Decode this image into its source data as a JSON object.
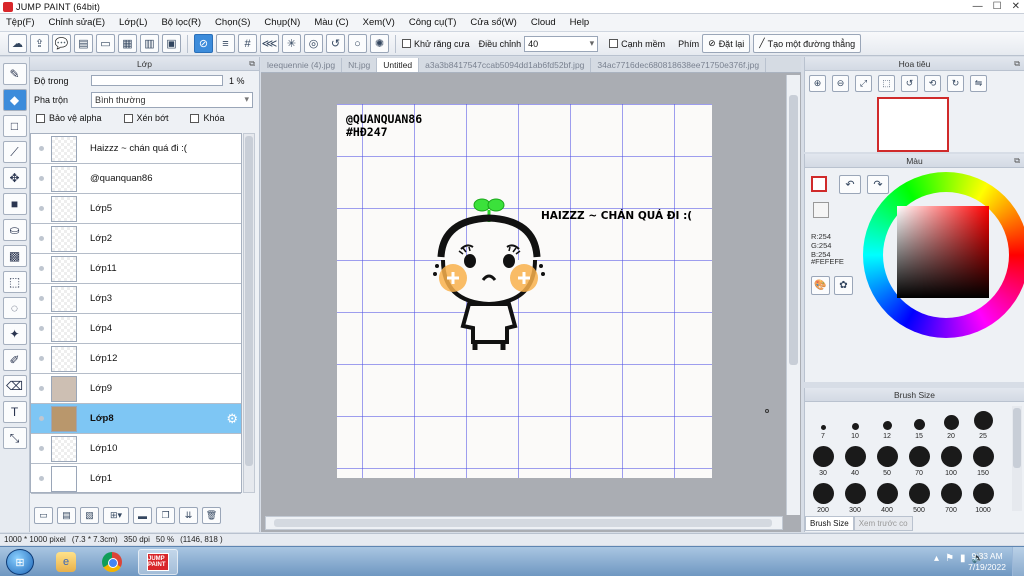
{
  "window": {
    "title": "JUMP PAINT (64bit)",
    "controls": [
      "—",
      "☐",
      "✕"
    ]
  },
  "menu": [
    "Tệp(F)",
    "Chỉnh sửa(E)",
    "Lớp(L)",
    "Bộ lọc(R)",
    "Chọn(S)",
    "Chụp(N)",
    "Màu (C)",
    "Xem(V)",
    "Công cụ(T)",
    "Cửa sổ(W)",
    "Cloud",
    "Help"
  ],
  "toolbar": {
    "antialias_label": "Khử răng cưa",
    "adjust_label": "Điều chỉnh",
    "adjust_value": "40",
    "soft_edge_label": "Cạnh mềm",
    "keyboard_label": "Phím",
    "reset_label": "Đặt lại",
    "straight_line_label": "Tạo một đường thẳng"
  },
  "layer_panel": {
    "title": "Lớp",
    "opacity_label": "Độ trong",
    "opacity_value": "1 %",
    "blend_label": "Pha trộn",
    "blend_value": "Bình thường",
    "protect_alpha": "Bảo vệ alpha",
    "clip": "Xén bớt",
    "lock": "Khóa",
    "layers": [
      {
        "name": "Haizzz ~ chán quá đi :(",
        "selected": false
      },
      {
        "name": "@quanquan86",
        "selected": false
      },
      {
        "name": "Lớp5",
        "selected": false
      },
      {
        "name": "Lớp2",
        "selected": false
      },
      {
        "name": "Lớp11",
        "selected": false
      },
      {
        "name": "Lớp3",
        "selected": false
      },
      {
        "name": "Lớp4",
        "selected": false
      },
      {
        "name": "Lớp12",
        "selected": false
      },
      {
        "name": "Lớp9",
        "selected": false
      },
      {
        "name": "Lớp8",
        "selected": true
      },
      {
        "name": "Lớp10",
        "selected": false
      },
      {
        "name": "Lớp1",
        "selected": false
      }
    ]
  },
  "canvas": {
    "tabs": [
      {
        "label": "leequennie (4).jpg",
        "active": false
      },
      {
        "label": "Nt.jpg",
        "active": false
      },
      {
        "label": "Untitled",
        "active": true
      },
      {
        "label": "a3a3b8417547ccab5094dd1ab6fd52bf.jpg",
        "active": false
      },
      {
        "label": "34ac7716dec680818638ee71750e376f.jpg",
        "active": false
      }
    ],
    "handle_line1": "@QUANQUAN86",
    "handle_line2": "#HĐ247",
    "caption": "HAIZZZ ~ CHÁN QUÁ ĐI :("
  },
  "navigator": {
    "title": "Hoa tiêu"
  },
  "color_panel": {
    "title": "Màu",
    "r": "R:254",
    "g": "G:254",
    "b": "B:254",
    "hex": "#FEFEFE"
  },
  "brush_panel": {
    "title": "Brush Size",
    "sizes": [
      "7",
      "10",
      "12",
      "15",
      "20",
      "25",
      "30",
      "40",
      "50",
      "70",
      "100",
      "150",
      "200",
      "300",
      "400",
      "500",
      "700",
      "1000"
    ],
    "tab_active": "Brush Size",
    "tab_inactive": "Xem trước co"
  },
  "status": {
    "size": "1000 * 1000 pixel",
    "physical": "(7.3 * 7.3cm)",
    "dpi": "350 dpi",
    "zoom": "50 %",
    "coords": "(1146, 818 )"
  },
  "taskbar": {
    "time": "9:33 AM",
    "date": "7/19/2022",
    "jp_icon_text": "JUMP PAINT"
  },
  "colors": {
    "accent": "#3c8cdb",
    "selected_row": "#7ec6f4",
    "grid": "#5050e6",
    "sprout_green": "#2bd62b",
    "cheek_orange": "#f8b04c"
  }
}
